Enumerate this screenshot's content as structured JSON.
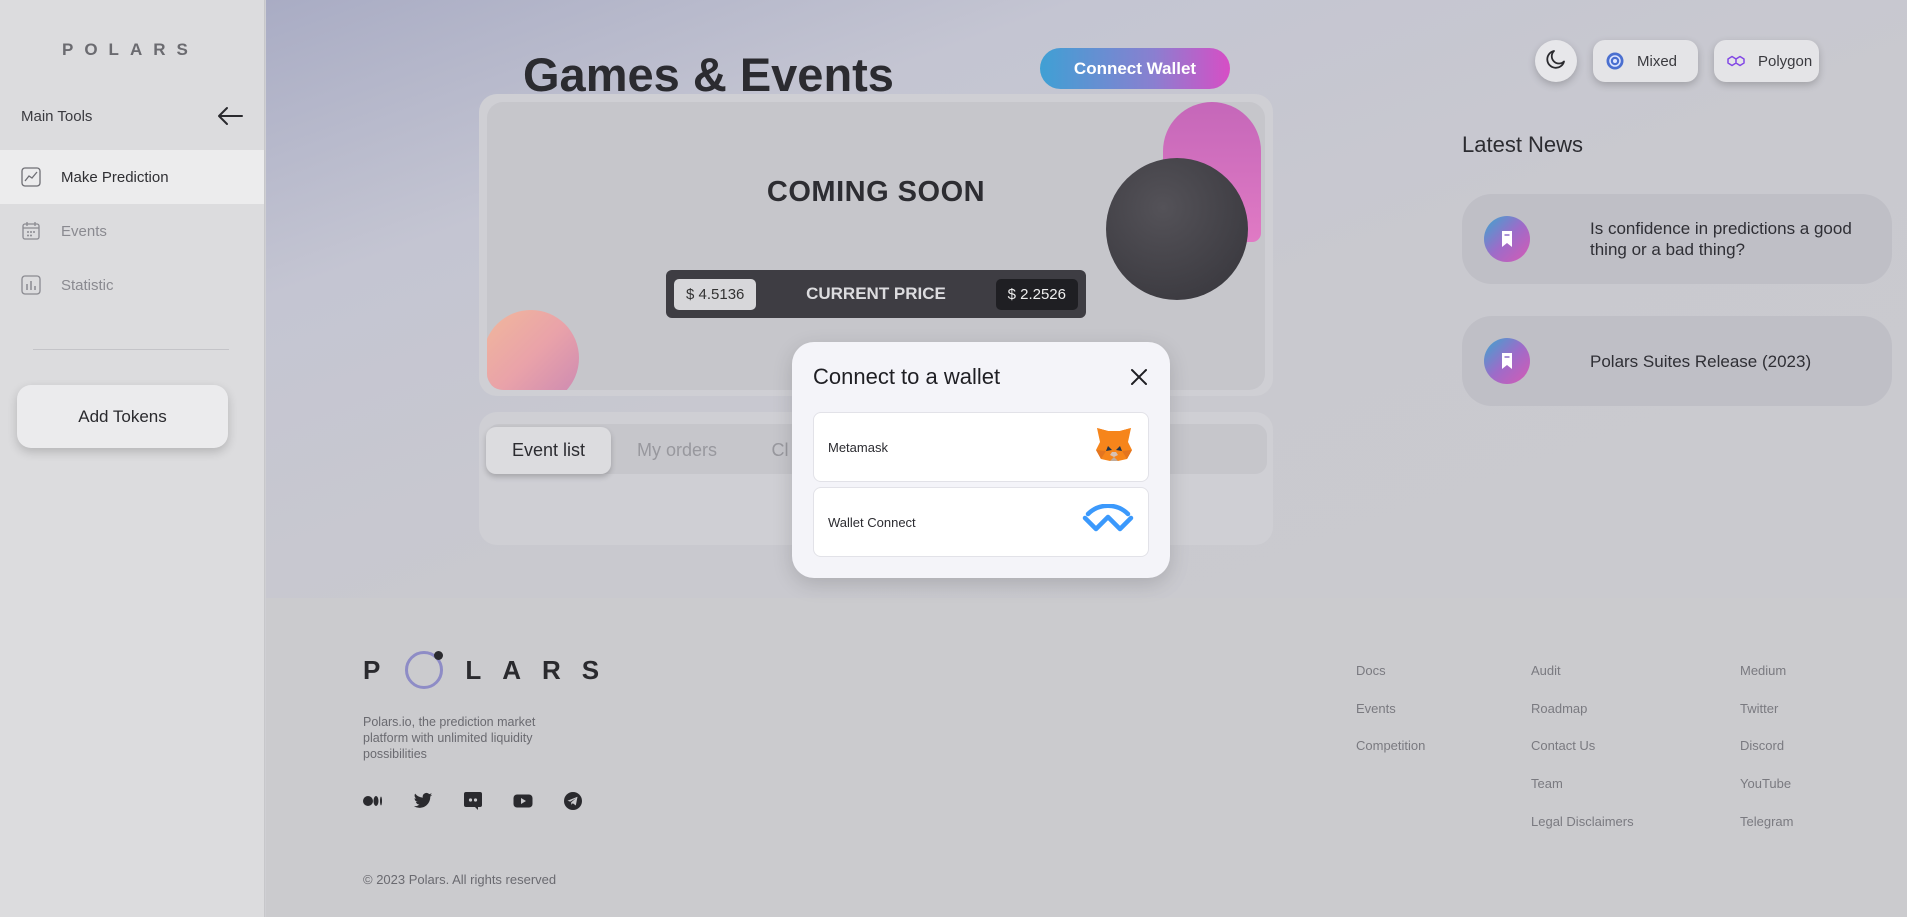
{
  "brand": {
    "logo_text": "POLARS"
  },
  "sidebar": {
    "heading": "Main Tools",
    "items": [
      {
        "label": "Make Prediction",
        "icon": "chart-line-icon",
        "active": true
      },
      {
        "label": "Events",
        "icon": "calendar-icon",
        "active": false
      },
      {
        "label": "Statistic",
        "icon": "bar-chart-icon",
        "active": false
      }
    ],
    "add_tokens": "Add Tokens"
  },
  "header": {
    "title": "Games & Events",
    "connect_wallet": "Connect Wallet",
    "theme_icon": "moon-icon",
    "mode_chip": "Mixed",
    "network_chip": "Polygon"
  },
  "card": {
    "status": "COMING SOON",
    "price_left": "$ 4.5136",
    "price_label": "CURRENT PRICE",
    "price_right": "$ 2.2526"
  },
  "tabs": [
    {
      "label": "Event list",
      "active": true
    },
    {
      "label": "My orders",
      "active": false
    },
    {
      "label": "Cl",
      "active": false
    }
  ],
  "news": {
    "title": "Latest News",
    "items": [
      {
        "text": "Is confidence in predictions a good thing or a bad thing?"
      },
      {
        "text": "Polars Suites Release (2023)"
      }
    ]
  },
  "modal": {
    "title": "Connect to a wallet",
    "options": [
      {
        "name": "Metamask",
        "icon": "metamask-fox-icon"
      },
      {
        "name": "Wallet Connect",
        "icon": "walletconnect-icon"
      }
    ]
  },
  "footer": {
    "logo_letters": {
      "p": "P",
      "rest": "LARS"
    },
    "description": "Polars.io, the prediction market platform with unlimited liquidity possibilities",
    "socials": [
      "medium-icon",
      "twitter-icon",
      "discord-icon",
      "youtube-icon",
      "telegram-icon"
    ],
    "copyright": "© 2023 Polars. All rights reserved",
    "col1": [
      "Docs",
      "Events",
      "Competition"
    ],
    "col2": [
      "Audit",
      "Roadmap",
      "Contact Us",
      "Team",
      "Legal Disclaimers"
    ],
    "col3": [
      "Medium",
      "Twitter",
      "Discord",
      "YouTube",
      "Telegram"
    ]
  },
  "colors": {
    "accent_gradient_start": "#3fa0d4",
    "accent_gradient_end": "#d74ec5",
    "price_bar": "#3e3d43"
  }
}
